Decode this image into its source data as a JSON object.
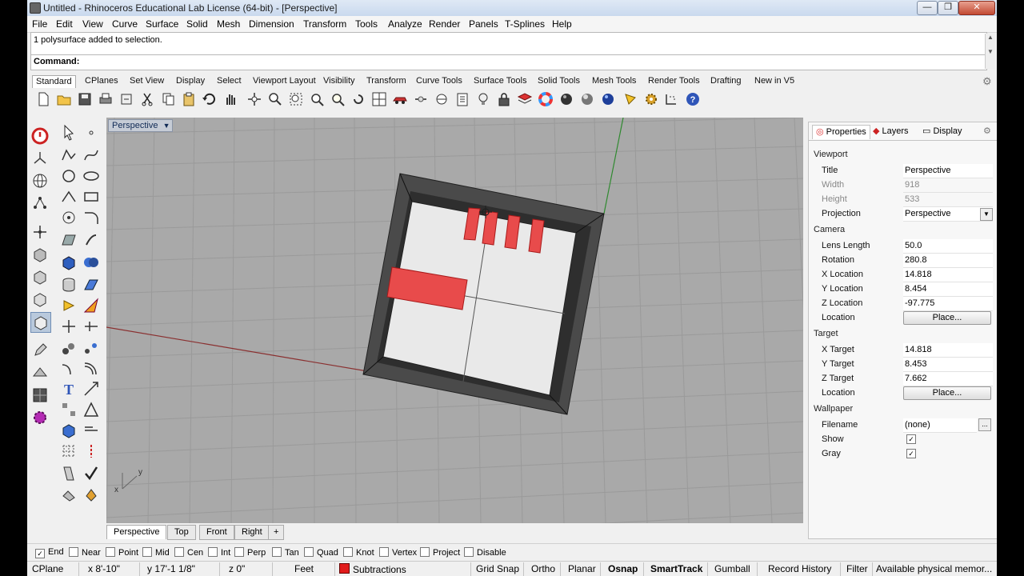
{
  "window": {
    "title": "Untitled - Rhinoceros Educational Lab License (64-bit) - [Perspective]",
    "minimize": "—",
    "restore": "❐",
    "close": "✕"
  },
  "menu": [
    "File",
    "Edit",
    "View",
    "Curve",
    "Surface",
    "Solid",
    "Mesh",
    "Dimension",
    "Transform",
    "Tools",
    "Analyze",
    "Render",
    "Panels",
    "T-Splines",
    "Help"
  ],
  "command": {
    "history": "1 polysurface added to selection.",
    "label": "Command:",
    "value": ""
  },
  "toolbar_tabs": [
    "Standard",
    "CPlanes",
    "Set View",
    "Display",
    "Select",
    "Viewport Layout",
    "Visibility",
    "Transform",
    "Curve Tools",
    "Surface Tools",
    "Solid Tools",
    "Mesh Tools",
    "Render Tools",
    "Drafting",
    "New in V5"
  ],
  "viewport": {
    "name": "Perspective",
    "dropdown": "▼",
    "axis_x": "x",
    "axis_y": "y",
    "tabs": [
      "Perspective",
      "Top",
      "Front",
      "Right"
    ],
    "add_tab": "+"
  },
  "panel": {
    "tabs": [
      "Properties",
      "Layers",
      "Display"
    ],
    "sections": {
      "viewport": "Viewport",
      "camera": "Camera",
      "target": "Target",
      "wallpaper": "Wallpaper"
    },
    "viewport_rows": [
      {
        "label": "Title",
        "value": "Perspective"
      },
      {
        "label": "Width",
        "value": "918"
      },
      {
        "label": "Height",
        "value": "533"
      },
      {
        "label": "Projection",
        "value": "Perspective"
      }
    ],
    "camera_rows": [
      {
        "label": "Lens Length",
        "value": "50.0"
      },
      {
        "label": "Rotation",
        "value": "280.8"
      },
      {
        "label": "X Location",
        "value": "14.818"
      },
      {
        "label": "Y Location",
        "value": "8.454"
      },
      {
        "label": "Z Location",
        "value": "-97.775"
      },
      {
        "label": "Location",
        "value": "Place..."
      }
    ],
    "target_rows": [
      {
        "label": "X Target",
        "value": "14.818"
      },
      {
        "label": "Y Target",
        "value": "8.453"
      },
      {
        "label": "Z Target",
        "value": "7.662"
      },
      {
        "label": "Location",
        "value": "Place..."
      }
    ],
    "wallpaper_rows": [
      {
        "label": "Filename",
        "value": "(none)"
      },
      {
        "label": "Show",
        "value": "✓"
      },
      {
        "label": "Gray",
        "value": "✓"
      }
    ],
    "browse_button": "..."
  },
  "osnap": [
    {
      "label": "End",
      "checked": true
    },
    {
      "label": "Near",
      "checked": false
    },
    {
      "label": "Point",
      "checked": false
    },
    {
      "label": "Mid",
      "checked": false
    },
    {
      "label": "Cen",
      "checked": false
    },
    {
      "label": "Int",
      "checked": false
    },
    {
      "label": "Perp",
      "checked": false
    },
    {
      "label": "Tan",
      "checked": false
    },
    {
      "label": "Quad",
      "checked": false
    },
    {
      "label": "Knot",
      "checked": false
    },
    {
      "label": "Vertex",
      "checked": false
    },
    {
      "label": "Project",
      "checked": false
    },
    {
      "label": "Disable",
      "checked": false
    }
  ],
  "status": {
    "cplane": "CPlane",
    "x": "x 8'-10\"",
    "y": "y 17'-1 1/8\"",
    "z": "z 0\"",
    "units": "Feet",
    "layer": "Subtractions",
    "layer_color": "#e11a1a",
    "grid_snap": "Grid Snap",
    "ortho": "Ortho",
    "planar": "Planar",
    "osnap": "Osnap",
    "smarttrack": "SmartTrack",
    "gumball": "Gumball",
    "record_history": "Record History",
    "filter": "Filter",
    "memory": "Available physical memor..."
  },
  "colors": {
    "selection": "#e84b4b",
    "viewport_bg": "#a9a9a9",
    "grid": "#9c9c9c"
  }
}
